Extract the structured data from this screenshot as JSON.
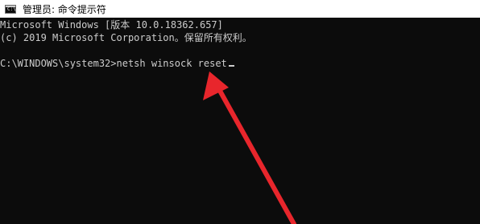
{
  "window": {
    "title": "管理员: 命令提示符",
    "icon": "cmd-console-icon",
    "icon_glyph": "C:\\"
  },
  "console": {
    "line1": "Microsoft Windows [版本 10.0.18362.657]",
    "line2": "(c) 2019 Microsoft Corporation。保留所有权利。",
    "line3": "",
    "prompt": "C:\\WINDOWS\\system32>",
    "command": "netsh winsock reset"
  },
  "colors": {
    "console_bg": "#0c0c0c",
    "console_fg": "#cccccc",
    "titlebar_bg": "#ffffff",
    "annotation_arrow": "#e8262c"
  }
}
